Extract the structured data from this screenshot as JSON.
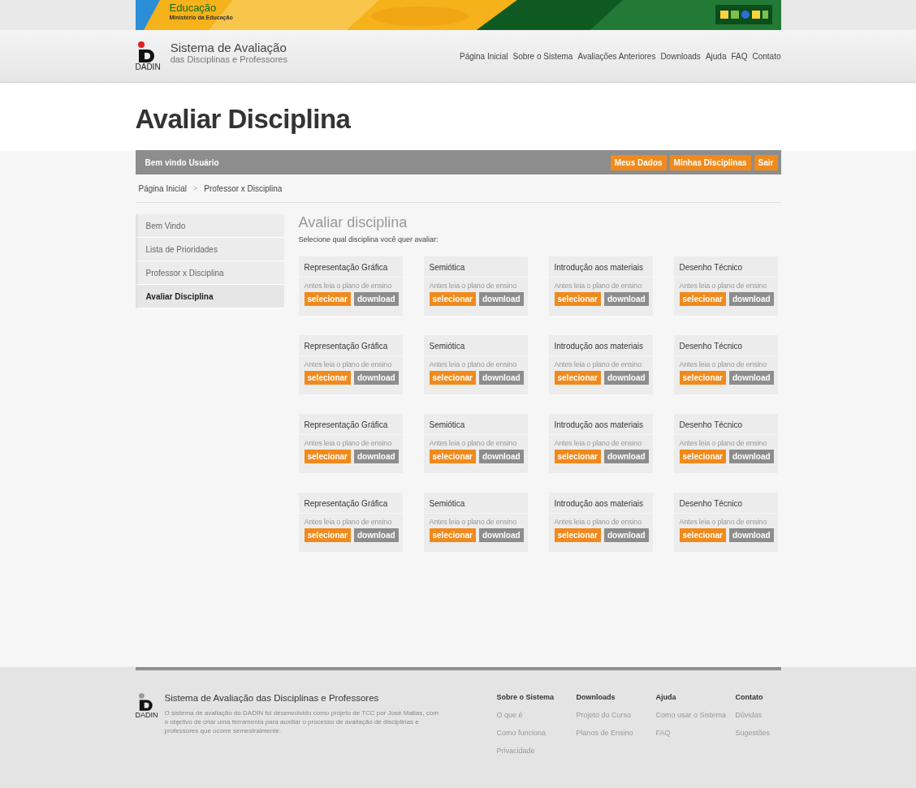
{
  "banner": {
    "title": "Educação",
    "subtitle": "Ministério da Educação"
  },
  "header": {
    "logo_text": "DADIN",
    "site_title": "Sistema de Avaliação",
    "site_subtitle": "das Disciplinas e Professores",
    "nav": [
      "Página Inicial",
      "Sobre o Sistema",
      "Avaliações Anteriores",
      "Downloads",
      "Ajuda",
      "FAQ",
      "Contato"
    ]
  },
  "page_title": "Avaliar Disciplina",
  "user_bar": {
    "greeting": "Bem vindo Usuário",
    "buttons": [
      "Meus Dados",
      "Minhas Disciplinas",
      "Sair"
    ]
  },
  "breadcrumb": {
    "items": [
      "Página Inicial",
      "Professor x Disciplina"
    ],
    "separator": ">"
  },
  "sidebar": {
    "items": [
      {
        "label": "Bem Vindo",
        "selected": false
      },
      {
        "label": "Lista de Prioridades",
        "selected": false
      },
      {
        "label": "Professor x Disciplina",
        "selected": false
      },
      {
        "label": "Avaliar Disciplina",
        "selected": true
      }
    ]
  },
  "main": {
    "heading": "Avaliar disciplina",
    "intro": "Selecione qual disciplina você quer avaliar:",
    "cards": [
      {
        "name": "Representação Gráfica",
        "note": "Antes leia o plano de ensino",
        "select": "selecionar",
        "download": "download"
      },
      {
        "name": "Semiótica",
        "note": "Antes leia o plano de ensino",
        "select": "selecionar",
        "download": "download"
      },
      {
        "name": "Introdução aos materiais",
        "note": "Antes leia o plano de ensino",
        "select": "selecionar",
        "download": "download"
      },
      {
        "name": "Desenho Técnico",
        "note": "Antes leia o plano de ensino",
        "select": "selecionar",
        "download": "download"
      },
      {
        "name": "Representação Gráfica",
        "note": "Antes leia o plano de ensino",
        "select": "selecionar",
        "download": "download"
      },
      {
        "name": "Semiótica",
        "note": "Antes leia o plano de ensino",
        "select": "selecionar",
        "download": "download"
      },
      {
        "name": "Introdução aos materiais",
        "note": "Antes leia o plano de ensino",
        "select": "selecionar",
        "download": "download"
      },
      {
        "name": "Desenho Técnico",
        "note": "Antes leia o plano de ensino",
        "select": "selecionar",
        "download": "download"
      },
      {
        "name": "Representação Gráfica",
        "note": "Antes leia o plano de ensino",
        "select": "selecionar",
        "download": "download"
      },
      {
        "name": "Semiótica",
        "note": "Antes leia o plano de ensino",
        "select": "selecionar",
        "download": "download"
      },
      {
        "name": "Introdução aos materiais",
        "note": "Antes leia o plano de ensino",
        "select": "selecionar",
        "download": "download"
      },
      {
        "name": "Desenho Técnico",
        "note": "Antes leia o plano de ensino",
        "select": "selecionar",
        "download": "download"
      },
      {
        "name": "Representação Gráfica",
        "note": "Antes leia o plano de ensino",
        "select": "selecionar",
        "download": "download"
      },
      {
        "name": "Semiótica",
        "note": "Antes leia o plano de ensino",
        "select": "selecionar",
        "download": "download"
      },
      {
        "name": "Introdução aos materiais",
        "note": "Antes leia o plano de ensino",
        "select": "selecionar",
        "download": "download"
      },
      {
        "name": "Desenho Técnico",
        "note": "Antes leia o plano de ensino",
        "select": "selecionar",
        "download": "download"
      }
    ]
  },
  "footer": {
    "logo_text": "DADIN",
    "title": "Sistema de Avaliação das Disciplinas e Professores",
    "description": "O sistema de avaliação do DADIN foi desenvolvido como projeto de TCC por José Matias, com o objetivo de criar uma ferramenta para auxiliar o processo de avaliação de disciplinas e professores que ocorre semestralmente.",
    "columns": [
      {
        "heading": "Sobre o Sistema",
        "links": [
          "O que é",
          "Como funciona",
          "Privacidade"
        ]
      },
      {
        "heading": "Downloads",
        "links": [
          "Projeto do Curso",
          "Planos de Ensino"
        ]
      },
      {
        "heading": "Ajuda",
        "links": [
          "Como usar o Sistema",
          "FAQ"
        ]
      },
      {
        "heading": "Contato",
        "links": [
          "Dúvidas",
          "Sugestões"
        ]
      }
    ]
  }
}
